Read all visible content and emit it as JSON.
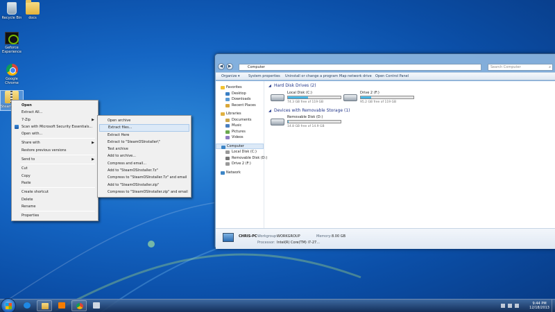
{
  "desktop": {
    "icons": [
      {
        "label": "Recycle Bin",
        "icon": "recycle-bin-icon"
      },
      {
        "label": "docs",
        "icon": "folder-icon"
      },
      {
        "label": "Geforce Experience",
        "icon": "geforce-icon"
      },
      {
        "label": "Google Chrome",
        "icon": "chrome-icon"
      },
      {
        "label": "SteamOSInstaller.zip",
        "icon": "zip-folder-icon"
      }
    ]
  },
  "context_menu": {
    "items": [
      {
        "label": "Open"
      },
      {
        "label": "Extract All..."
      },
      {
        "label": "7-Zip"
      },
      {
        "label": "Scan with Microsoft Security Essentials..."
      },
      {
        "label": "Open with..."
      },
      {
        "label": "Share with"
      },
      {
        "label": "Restore previous versions"
      },
      {
        "label": "Send to"
      },
      {
        "label": "Cut"
      },
      {
        "label": "Copy"
      },
      {
        "label": "Paste"
      },
      {
        "label": "Create shortcut"
      },
      {
        "label": "Delete"
      },
      {
        "label": "Rename"
      },
      {
        "label": "Properties"
      }
    ]
  },
  "submenu_7zip": {
    "items": [
      {
        "label": "Open archive"
      },
      {
        "label": "Extract files..."
      },
      {
        "label": "Extract Here"
      },
      {
        "label": "Extract to \"SteamOSInstaller\\\""
      },
      {
        "label": "Test archive"
      },
      {
        "label": "Add to archive..."
      },
      {
        "label": "Compress and email..."
      },
      {
        "label": "Add to \"SteamOSInstaller.7z\""
      },
      {
        "label": "Compress to \"SteamOSInstaller.7z\" and email"
      },
      {
        "label": "Add to \"SteamOSInstaller.zip\""
      },
      {
        "label": "Compress to \"SteamOSInstaller.zip\" and email"
      }
    ]
  },
  "explorer": {
    "address": "Computer",
    "search_placeholder": "Search Computer",
    "toolbar": {
      "organize": "Organize ▾",
      "system_properties": "System properties",
      "uninstall": "Uninstall or change a program",
      "map_drive": "Map network drive",
      "control_panel": "Open Control Panel"
    },
    "nav": {
      "favorites": "Favorites",
      "desktop": "Desktop",
      "downloads": "Downloads",
      "recent": "Recent Places",
      "libraries": "Libraries",
      "documents": "Documents",
      "music": "Music",
      "pictures": "Pictures",
      "videos": "Videos",
      "computer": "Computer",
      "local_disk": "Local Disk (C:)",
      "removable": "Removable Disk (D:)",
      "drive2": "Drive 2 (F:)",
      "network": "Network"
    },
    "groups": {
      "hdd": "Hard Disk Drives (2)",
      "removable": "Devices with Removable Storage (1)"
    },
    "drives": [
      {
        "name": "Local Disk (C:)",
        "free": "74.3 GB free of 119 GB",
        "used_fraction": 0.38
      },
      {
        "name": "Drive 2 (F:)",
        "free": "95.2 GB free of 119 GB",
        "used_fraction": 0.2
      },
      {
        "name": "Removable Disk (D:)",
        "free": "14.8 GB free of 14.9 GB",
        "used_fraction": 0.01
      }
    ],
    "details": {
      "pc_name": "CHRIS-PC",
      "workgroup_label": "Workgroup:",
      "workgroup": "WORKGROUP",
      "memory_label": "Memory:",
      "memory": "8.00 GB",
      "processor_label": "Processor:",
      "processor": "Intel(R) Core(TM) i7-27..."
    }
  },
  "taskbar": {
    "time": "9:44 PM",
    "date": "12/18/2013"
  },
  "colors": {
    "desktop_blue": "#1566c4",
    "menu_highlight": "#dce9f7",
    "disk_fill": "#26a0da"
  }
}
